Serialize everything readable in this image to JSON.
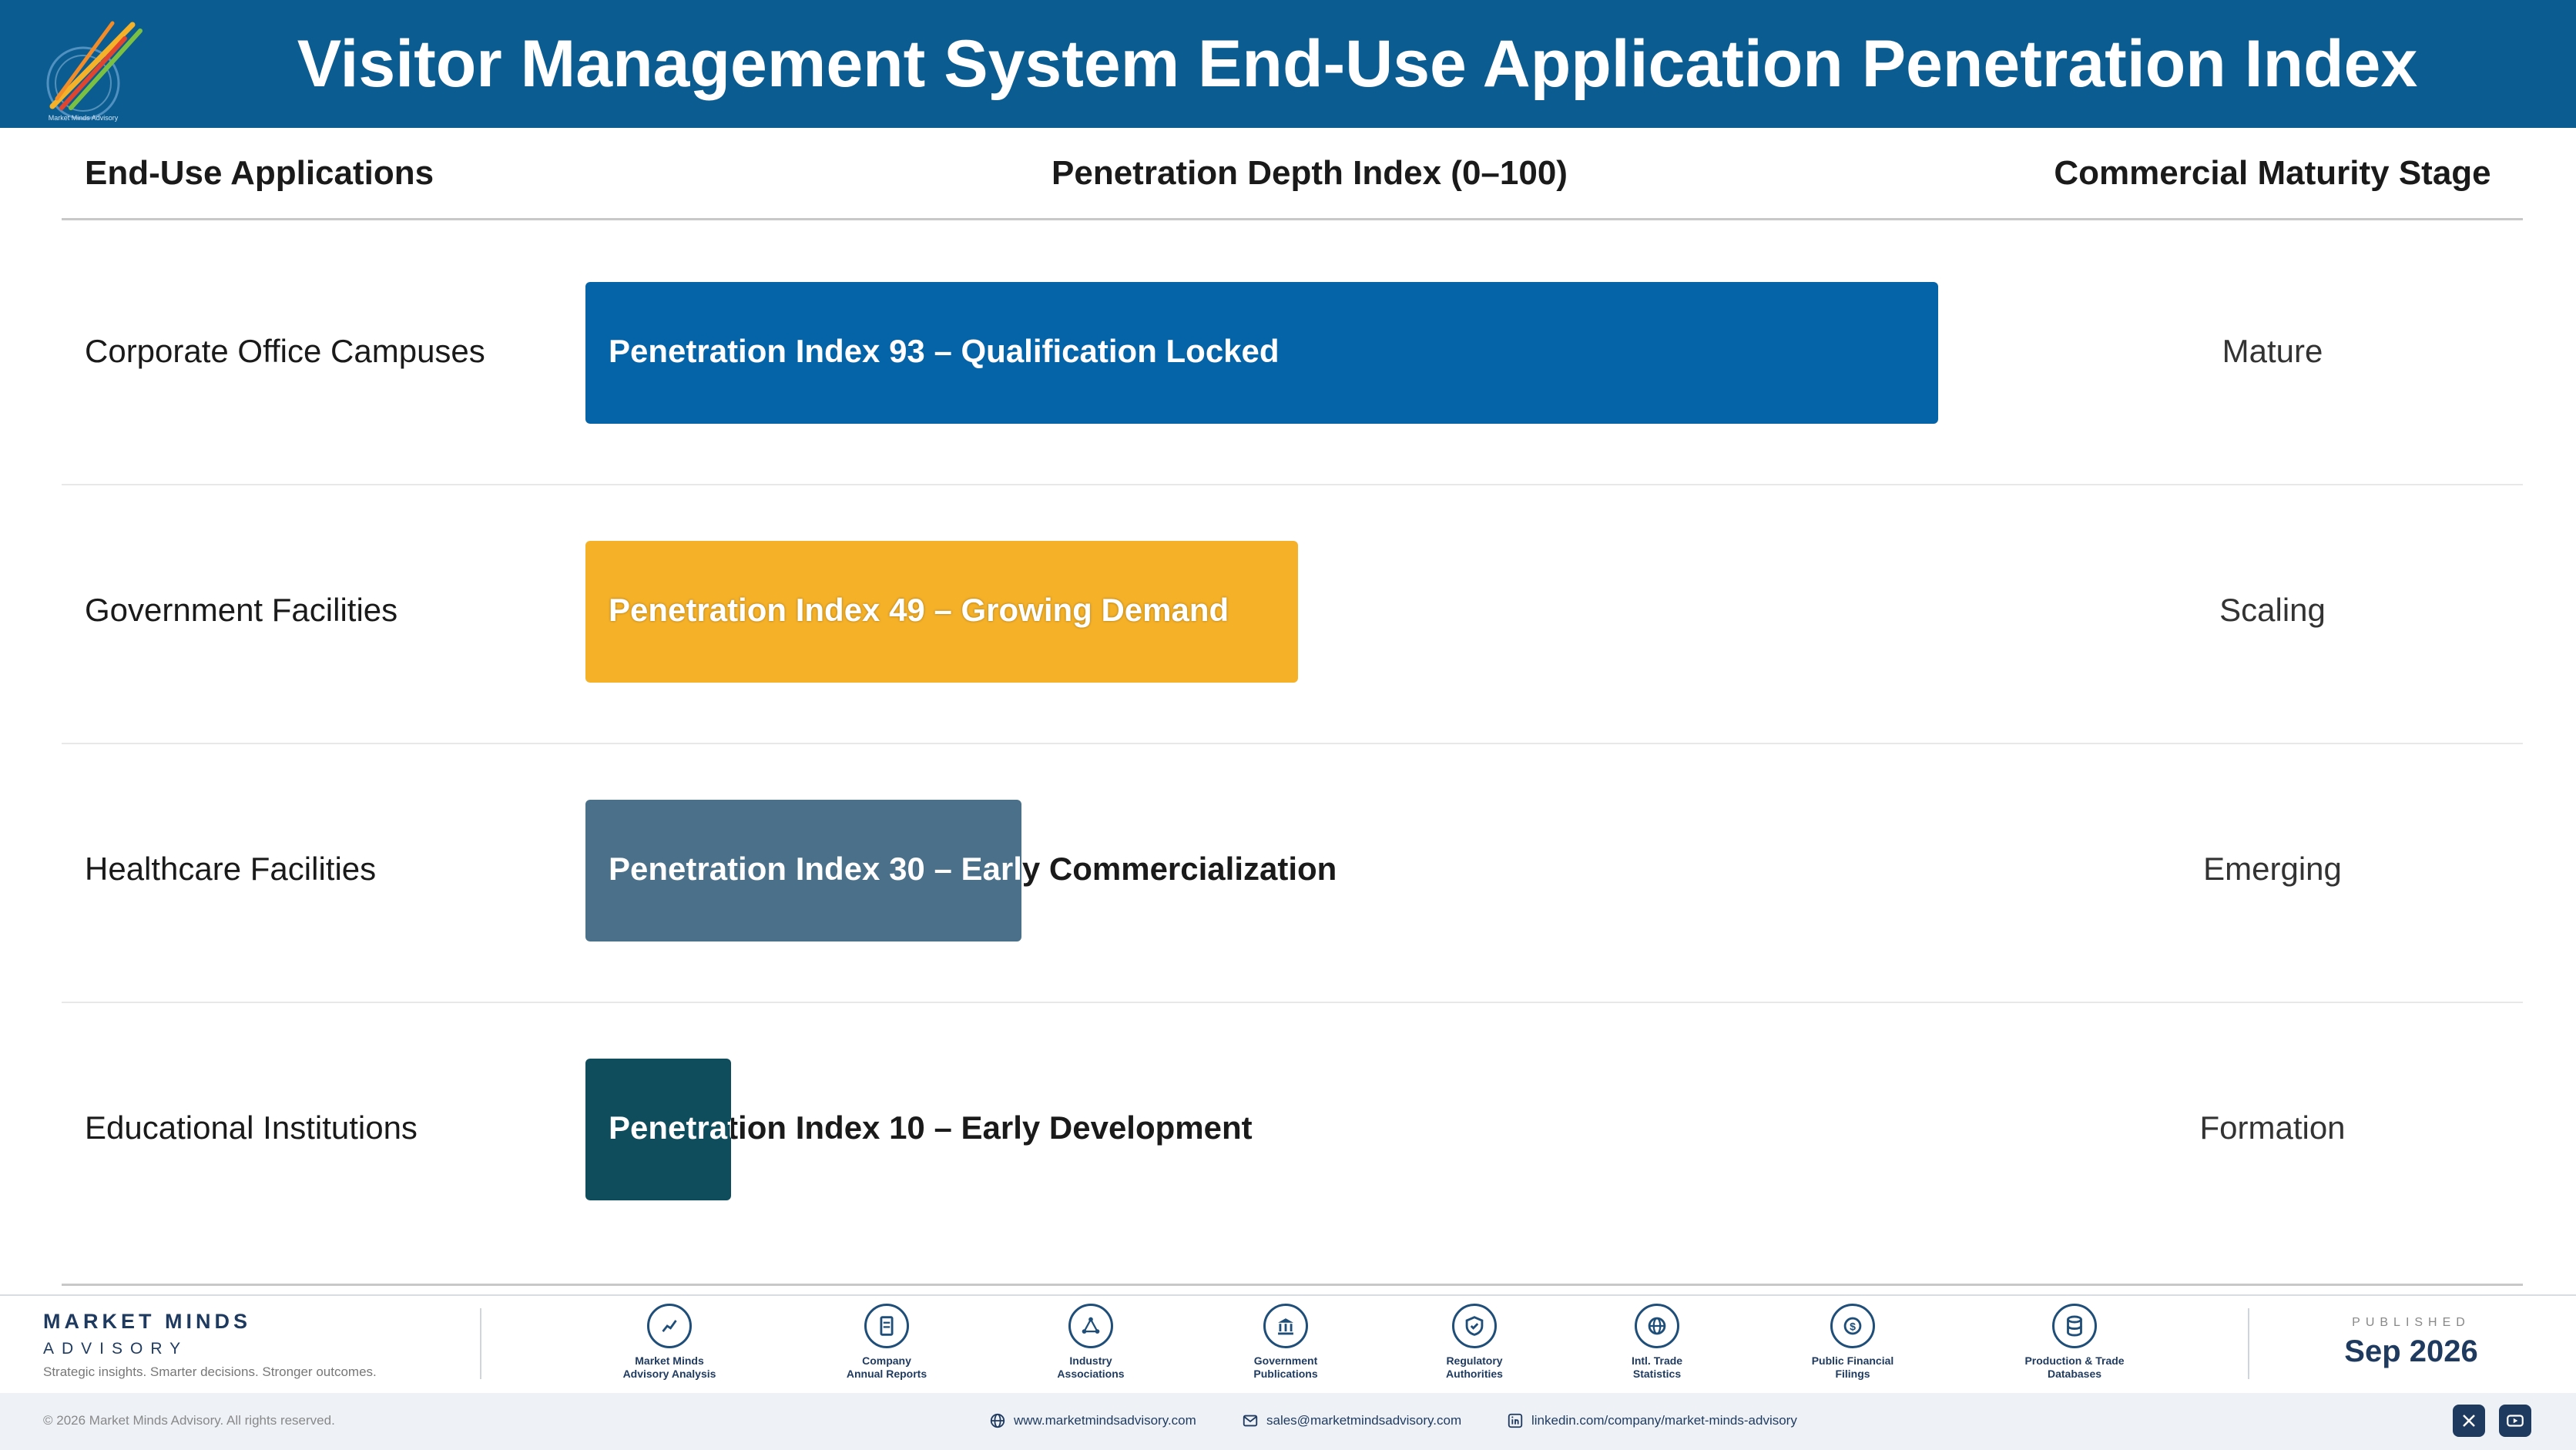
{
  "header": {
    "title": "Visitor Management System End-Use Application Penetration Index",
    "logo_text": "Market Minds Advisory"
  },
  "columns": {
    "applications": "End-Use Applications",
    "index": "Penetration Depth Index (0–100)",
    "stage": "Commercial Maturity Stage"
  },
  "chart_data": {
    "type": "bar",
    "orientation": "horizontal",
    "xlim": [
      0,
      100
    ],
    "categories": [
      "Corporate Office Campuses",
      "Government Facilities",
      "Healthcare Facilities",
      "Educational Institutions"
    ],
    "values": [
      93,
      49,
      30,
      10
    ],
    "bar_labels": [
      "Penetration Index 93 – Qualification Locked",
      "Penetration Index 49 – Growing Demand",
      "Penetration Index 30 – Early Commercialization",
      "Penetration Index 10 – Early Development"
    ],
    "stages": [
      "Mature",
      "Scaling",
      "Emerging",
      "Formation"
    ],
    "colors": [
      "#0563a8",
      "#f5b128",
      "#4a7189",
      "#0f4c5c"
    ]
  },
  "footer": {
    "brand_name": "MARKET MINDS",
    "brand_sub": "ADVISORY",
    "tagline": "Strategic insights. Smarter decisions. Stronger outcomes.",
    "sources": [
      {
        "line1": "Market Minds",
        "line2": "Advisory Analysis",
        "icon": "chart-line-icon"
      },
      {
        "line1": "Company",
        "line2": "Annual Reports",
        "icon": "document-icon"
      },
      {
        "line1": "Industry",
        "line2": "Associations",
        "icon": "network-icon"
      },
      {
        "line1": "Government",
        "line2": "Publications",
        "icon": "government-building-icon"
      },
      {
        "line1": "Regulatory",
        "line2": "Authorities",
        "icon": "shield-check-icon"
      },
      {
        "line1": "Intl. Trade",
        "line2": "Statistics",
        "icon": "globe-icon"
      },
      {
        "line1": "Public Financial",
        "line2": "Filings",
        "icon": "dollar-coin-icon"
      },
      {
        "line1": "Production & Trade",
        "line2": "Databases",
        "icon": "database-icon"
      }
    ],
    "published_label": "PUBLISHED",
    "published_date": "Sep 2026",
    "copyright": "© 2026 Market Minds Advisory. All rights reserved.",
    "website": "www.marketmindsadvisory.com",
    "email": "sales@marketmindsadvisory.com",
    "linkedin": "linkedin.com/company/market-minds-advisory"
  }
}
